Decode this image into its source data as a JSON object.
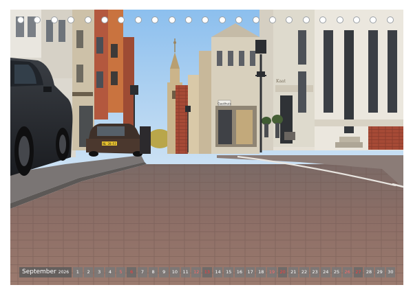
{
  "calendar": {
    "month": "September",
    "year": "2026",
    "days": [
      {
        "n": "1",
        "k": ""
      },
      {
        "n": "2",
        "k": ""
      },
      {
        "n": "3",
        "k": ""
      },
      {
        "n": "4",
        "k": ""
      },
      {
        "n": "5",
        "k": "sat"
      },
      {
        "n": "6",
        "k": "sun"
      },
      {
        "n": "7",
        "k": ""
      },
      {
        "n": "8",
        "k": ""
      },
      {
        "n": "9",
        "k": ""
      },
      {
        "n": "10",
        "k": ""
      },
      {
        "n": "11",
        "k": ""
      },
      {
        "n": "12",
        "k": "sat"
      },
      {
        "n": "13",
        "k": "sun"
      },
      {
        "n": "14",
        "k": ""
      },
      {
        "n": "15",
        "k": ""
      },
      {
        "n": "16",
        "k": ""
      },
      {
        "n": "17",
        "k": ""
      },
      {
        "n": "18",
        "k": ""
      },
      {
        "n": "19",
        "k": "sat"
      },
      {
        "n": "20",
        "k": "sun"
      },
      {
        "n": "21",
        "k": ""
      },
      {
        "n": "22",
        "k": ""
      },
      {
        "n": "23",
        "k": ""
      },
      {
        "n": "24",
        "k": ""
      },
      {
        "n": "25",
        "k": ""
      },
      {
        "n": "26",
        "k": "sat"
      },
      {
        "n": "27",
        "k": "sun"
      },
      {
        "n": "28",
        "k": ""
      },
      {
        "n": "29",
        "k": ""
      },
      {
        "n": "30",
        "k": ""
      }
    ]
  },
  "photo": {
    "street_sign": "Gasthuis",
    "shop_sign": "Kaat",
    "license_plate": "NL 28-FJ"
  },
  "colors": {
    "sky": "#9fc8ee",
    "cobblestone": "#8a6c64",
    "building_light": "#e7e2d8",
    "brick": "#b5543c"
  }
}
